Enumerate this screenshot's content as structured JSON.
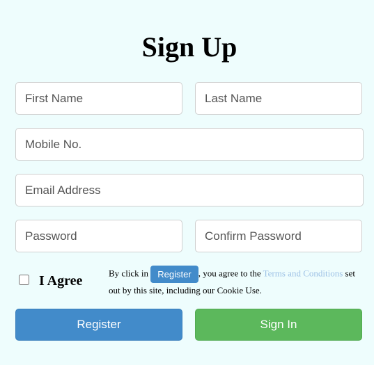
{
  "form": {
    "title": "Sign Up",
    "fields": {
      "first_name": {
        "placeholder": "First Name",
        "value": ""
      },
      "last_name": {
        "placeholder": "Last Name",
        "value": ""
      },
      "mobile": {
        "placeholder": "Mobile No.",
        "value": ""
      },
      "email": {
        "placeholder": "Email Address",
        "value": ""
      },
      "password": {
        "placeholder": "Password",
        "value": ""
      },
      "confirm_password": {
        "placeholder": "Confirm Password",
        "value": ""
      }
    },
    "agree": {
      "label": "I Agree",
      "checked": false
    },
    "terms": {
      "prefix": "By click in",
      "button_label": "Register",
      "middle": ", you agree to the",
      "link_text": "Terms and Conditions",
      "suffix": "set out by this site, including our Cookie Use."
    },
    "buttons": {
      "register": "Register",
      "sign_in": "Sign In"
    }
  },
  "colors": {
    "background": "#eefdfd",
    "register_button": "#428bca",
    "sign_in_button": "#5cb85c",
    "terms_link": "#9ec2e6"
  }
}
